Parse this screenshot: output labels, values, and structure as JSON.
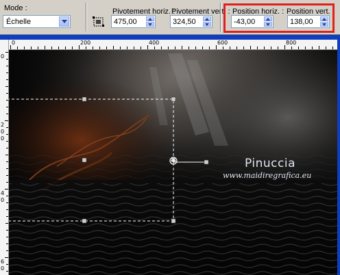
{
  "toolbar": {
    "mode_label": "Mode :",
    "mode_value": "Échelle",
    "pivot_h_label": "Pivotement horiz. :",
    "pivot_h_value": "475,00",
    "pivot_v_label": "Pivotement vert. :",
    "pivot_v_value": "324,50",
    "pos_h_label": "Position horiz. :",
    "pos_h_value": "-43,00",
    "pos_v_label": "Position vert. :",
    "pos_v_value": "138,00"
  },
  "ruler": {
    "top_labels": [
      "0",
      "200",
      "400",
      "600",
      "800"
    ],
    "left_labels": [
      "0",
      "2",
      "0",
      "0",
      "4",
      "0",
      "6",
      "0"
    ]
  },
  "canvas": {
    "watermark_title": "Pinuccia",
    "watermark_url": "www.maidiregrafica.eu"
  },
  "colors": {
    "highlight": "#e0201c",
    "workspace": "#0f3fbf",
    "panel": "#d4d0c8"
  },
  "icons": [
    "chevron-down-icon",
    "spin-up-icon",
    "spin-down-icon",
    "deform-tool-icon",
    "pivot-handle-icon"
  ]
}
